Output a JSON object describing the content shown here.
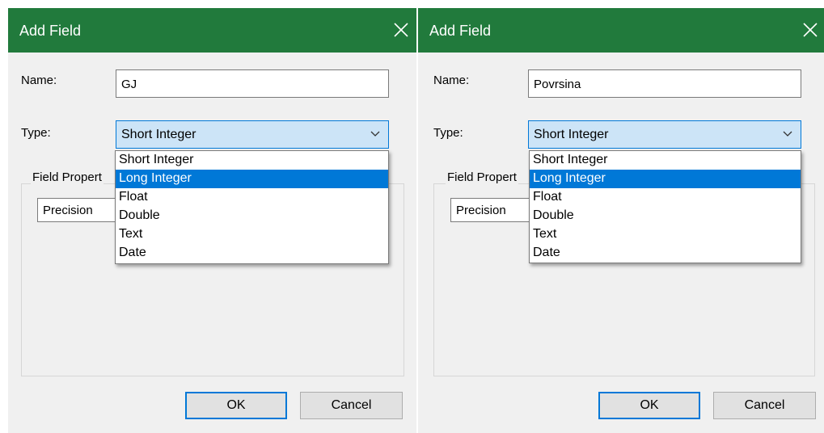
{
  "dialogs": [
    {
      "title": "Add Field",
      "name_label": "Name:",
      "name_value": "GJ",
      "type_label": "Type:",
      "type_value": "Short Integer",
      "group_label": "Field Propert",
      "precision_label": "Precision",
      "options": [
        "Short Integer",
        "Long Integer",
        "Float",
        "Double",
        "Text",
        "Date"
      ],
      "highlighted_option": "Long Integer",
      "ok_label": "OK",
      "cancel_label": "Cancel"
    },
    {
      "title": "Add Field",
      "name_label": "Name:",
      "name_value": "Povrsina",
      "type_label": "Type:",
      "type_value": "Short Integer",
      "group_label": "Field Propert",
      "precision_label": "Precision",
      "options": [
        "Short Integer",
        "Long Integer",
        "Float",
        "Double",
        "Text",
        "Date"
      ],
      "highlighted_option": "Long Integer",
      "ok_label": "OK",
      "cancel_label": "Cancel"
    }
  ],
  "colors": {
    "titlebar": "#217a3c",
    "dialog_bg": "#f0f0f0",
    "selection": "#0078d7",
    "combo_bg": "#cce4f7"
  },
  "icons": {
    "close": "close-icon",
    "dropdown": "chevron-down-icon"
  }
}
